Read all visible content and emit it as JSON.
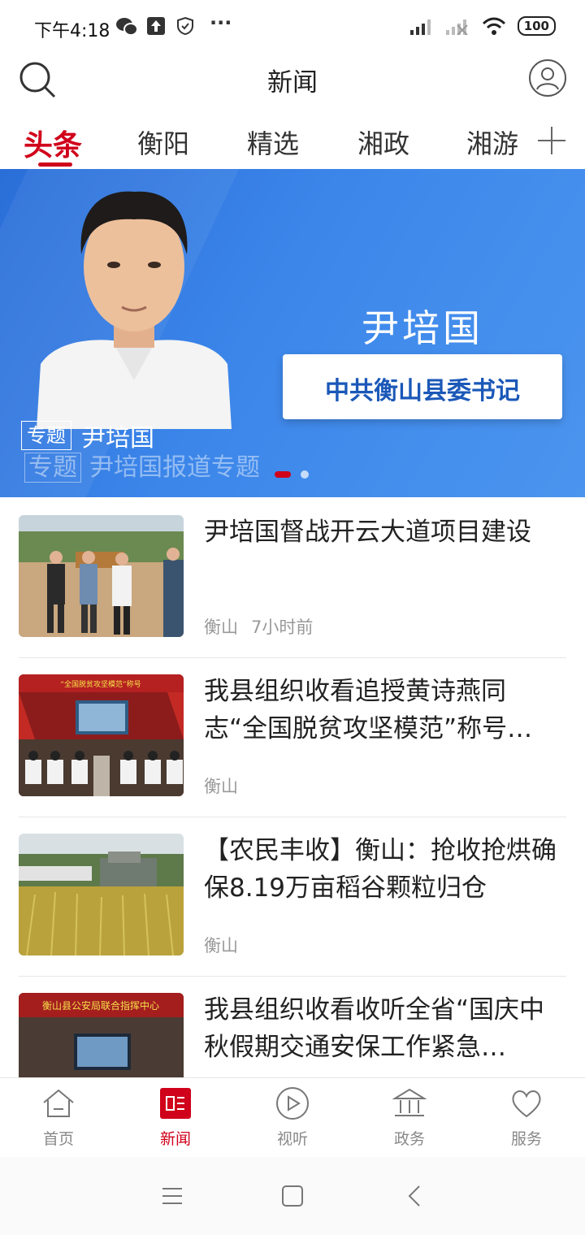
{
  "status_bar": {
    "time": "下午4:18",
    "battery": "100"
  },
  "header": {
    "title": "新闻"
  },
  "tabs": [
    {
      "label": "头条",
      "active": true
    },
    {
      "label": "衡阳"
    },
    {
      "label": "精选"
    },
    {
      "label": "湘政"
    },
    {
      "label": "湘游"
    }
  ],
  "banner": {
    "person_name": "尹培国",
    "role": "中共衡山县委书记",
    "badge": "专题",
    "caption": "尹培国",
    "subcaption_badge": "专题",
    "subcaption": "尹培国报道专题",
    "dots": 2,
    "active_dot": 0
  },
  "news": [
    {
      "title": "尹培国督战开云大道项目建设",
      "source": "衡山",
      "time": "7小时前"
    },
    {
      "title": "我县组织收看追授黄诗燕同志“全国脱贫攻坚模范”称号…",
      "source": "衡山",
      "time": ""
    },
    {
      "title": "【农民丰收】衡山：抢收抢烘确保8.19万亩稻谷颗粒归仓",
      "source": "衡山",
      "time": ""
    },
    {
      "title": "我县组织收看收听全省“国庆中秋假期交通安保工作紧急…",
      "source": "",
      "time": "",
      "thumb_text": "衡山县公安局联合指挥中心"
    }
  ],
  "thumb2_text": "“全国脱贫攻坚模范”称号",
  "bottom_nav": [
    {
      "label": "首页",
      "icon": "home-icon"
    },
    {
      "label": "新闻",
      "icon": "news-icon",
      "active": true
    },
    {
      "label": "视听",
      "icon": "play-icon"
    },
    {
      "label": "政务",
      "icon": "government-icon"
    },
    {
      "label": "服务",
      "icon": "heart-icon"
    }
  ],
  "colors": {
    "accent": "#d0021b",
    "banner_blue": "#3c86ea"
  }
}
